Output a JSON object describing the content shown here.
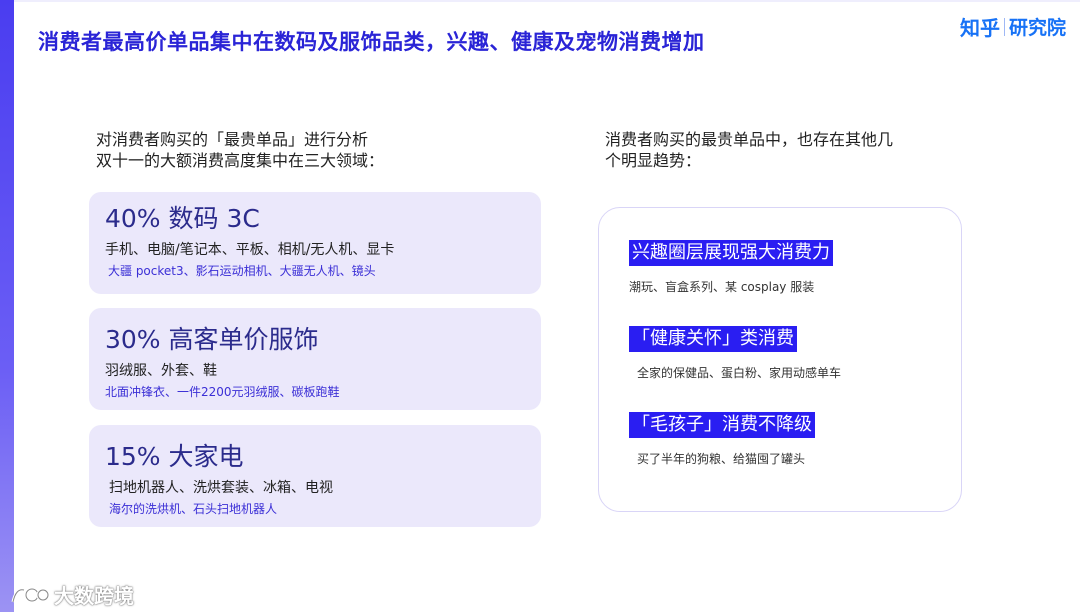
{
  "title": "消费者最高价单品集中在数码及服饰品类，兴趣、健康及宠物消费增加",
  "logo": {
    "zhihu": "知乎",
    "yanjiuyuan": "研究院"
  },
  "intro_left": [
    "对消费者购买的「最贵单品」进行分析",
    "双十一的大额消费高度集中在三大领域："
  ],
  "intro_right": [
    "消费者购买的最贵单品中，也存在其他几",
    "个明显趋势："
  ],
  "categories": [
    {
      "headline": "40%  数码 3C",
      "items": "手机、电脑/笔记本、平板、相机/无人机、显卡",
      "examples": "大疆 pocket3、影石运动相机、大疆无人机、镜头"
    },
    {
      "headline": "30% 高客单价服饰",
      "items": "羽绒服、外套、鞋",
      "examples": "北面冲锋衣、一件2200元羽绒服、碳板跑鞋"
    },
    {
      "headline": "15% 大家电",
      "items": "扫地机器人、洗烘套装、冰箱、电视",
      "examples": "海尔的洗烘机、石头扫地机器人"
    }
  ],
  "trends": [
    {
      "headline": "兴趣圈层展现强大消费力",
      "desc": "潮玩、盲盒系列、某 cosplay 服装"
    },
    {
      "headline": "「健康关怀」类消费",
      "desc": "全家的保健品、蛋白粉、家用动感单车"
    },
    {
      "headline": "「毛孩子」消费不降级",
      "desc": "买了半年的狗粮、给猫囤了罐头"
    }
  ],
  "watermark": "大数跨境",
  "colors": {
    "accent": "#2a24d6",
    "card_bg": "#ebe8fb",
    "highlight": "#2a1ef2",
    "logo": "#1772f6"
  }
}
